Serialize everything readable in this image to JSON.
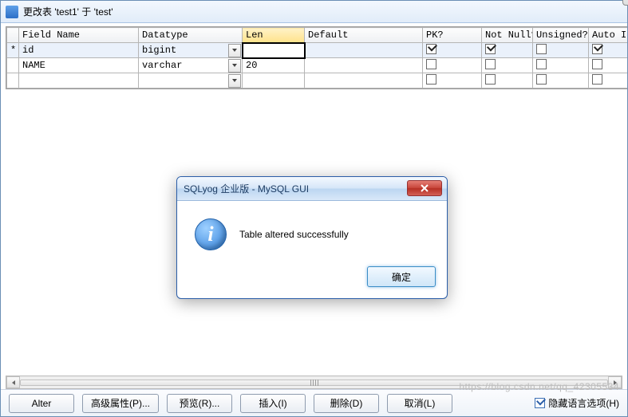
{
  "window": {
    "title": "更改表 'test1' 于 'test'"
  },
  "columns": {
    "field_name": "Field Name",
    "datatype": "Datatype",
    "len": "Len",
    "default": "Default",
    "pk": "PK?",
    "not_null": "Not Null?",
    "unsigned": "Unsigned?",
    "auto_inc": "Auto Incr"
  },
  "rows": [
    {
      "marker": "*",
      "field": "id",
      "datatype": "bigint",
      "len": "",
      "default": "",
      "pk": true,
      "nn": true,
      "un": false,
      "ai": true
    },
    {
      "marker": "",
      "field": "NAME",
      "datatype": "varchar",
      "len": "20",
      "default": "",
      "pk": false,
      "nn": false,
      "un": false,
      "ai": false
    },
    {
      "marker": "",
      "field": "",
      "datatype": "",
      "len": "",
      "default": "",
      "pk": false,
      "nn": false,
      "un": false,
      "ai": false
    }
  ],
  "buttons": {
    "alter": "Alter",
    "advprops": "高级属性(P)...",
    "preview": "预览(R)...",
    "insert": "插入(I)",
    "delete": "删除(D)",
    "cancel": "取消(L)"
  },
  "hide_lang": {
    "label": "隐藏语言选项(H)",
    "checked": true
  },
  "dialog": {
    "title": "SQLyog 企业版 - MySQL GUI",
    "message": "Table altered successfully",
    "ok": "确定"
  },
  "watermark": "https://blog.csdn.net/qq_42305534"
}
